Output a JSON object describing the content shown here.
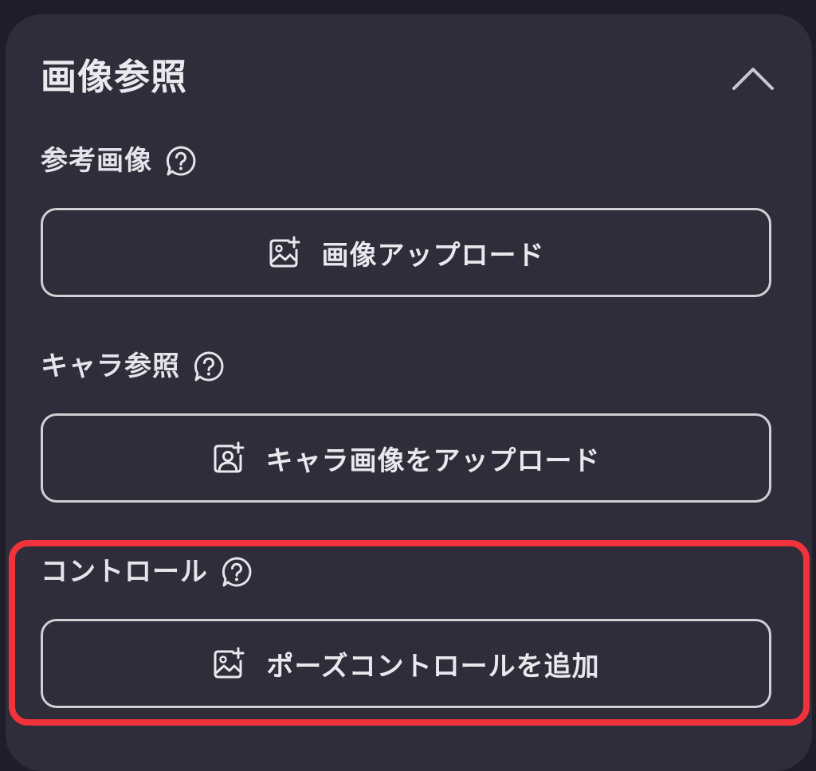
{
  "panel": {
    "title": "画像参照",
    "collapse_icon": "chevron-up-icon"
  },
  "sections": [
    {
      "label": "参考画像",
      "help_icon": "help-bubble-icon",
      "button_label": "画像アップロード",
      "button_icon": "image-plus-icon"
    },
    {
      "label": "キャラ参照",
      "help_icon": "help-bubble-icon",
      "button_label": "キャラ画像をアップロード",
      "button_icon": "person-plus-icon"
    },
    {
      "label": "コントロール",
      "help_icon": "help-bubble-icon",
      "button_label": "ポーズコントロールを追加",
      "button_icon": "image-plus-icon"
    }
  ],
  "colors": {
    "page_background": "#1f1e28",
    "panel_background": "#2e2d39",
    "text": "#e8e8ed",
    "button_border": "#cfcfd4",
    "highlight": "#f2323b"
  }
}
